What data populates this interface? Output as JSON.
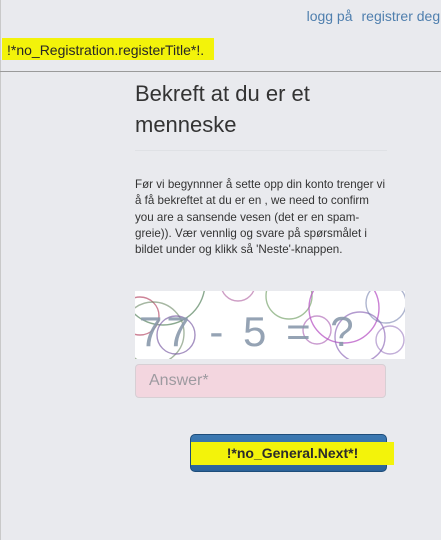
{
  "nav": {
    "login_label": "logg på",
    "register_label": "registrer deg."
  },
  "header": {
    "title": "!*no_Registration.registerTitle*!."
  },
  "main": {
    "title": "Bekreft at du er et menneske",
    "instructions": "Før vi begynnner å sette opp din konto trenger vi å få bekreftet at du er en , we need to confirm you are a sansende vesen (det er en spam-greie)). Vær vennlig og svare på spørsmålet i bildet under og klikk så 'Neste'-knappen."
  },
  "captcha": {
    "question_text": "77 - 5 = ?"
  },
  "answer": {
    "value": "",
    "placeholder": "Answer*"
  },
  "next_button": {
    "label": "!*no_General.Next*!"
  },
  "colors": {
    "background": "#e9eaee",
    "link": "#4f7fae",
    "highlight": "#f3f30a",
    "button": "#2b6298",
    "answer_field_background": "#f3d6df"
  },
  "icons": []
}
